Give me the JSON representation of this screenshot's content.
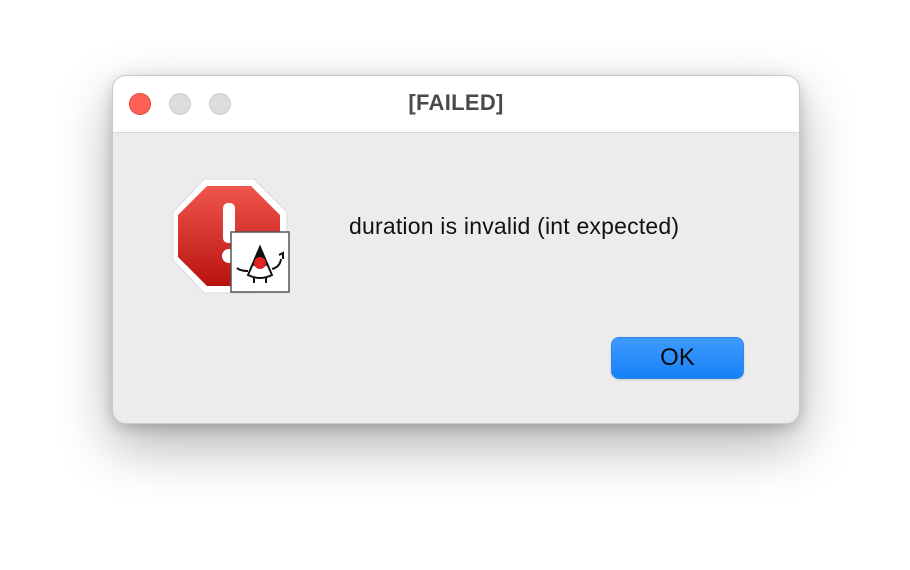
{
  "window": {
    "title": "[FAILED]",
    "traffic_lights": {
      "close_color": "#fe5f57",
      "inactive_color": "#dcdcdc"
    }
  },
  "dialog": {
    "icon": "error-stop-icon",
    "badge_icon": "java-duke-icon",
    "message": "duration is invalid (int expected)",
    "ok_label": "OK"
  },
  "colors": {
    "accent": "#1681f7",
    "error_red": "#d7302c",
    "background": "#ececec"
  }
}
